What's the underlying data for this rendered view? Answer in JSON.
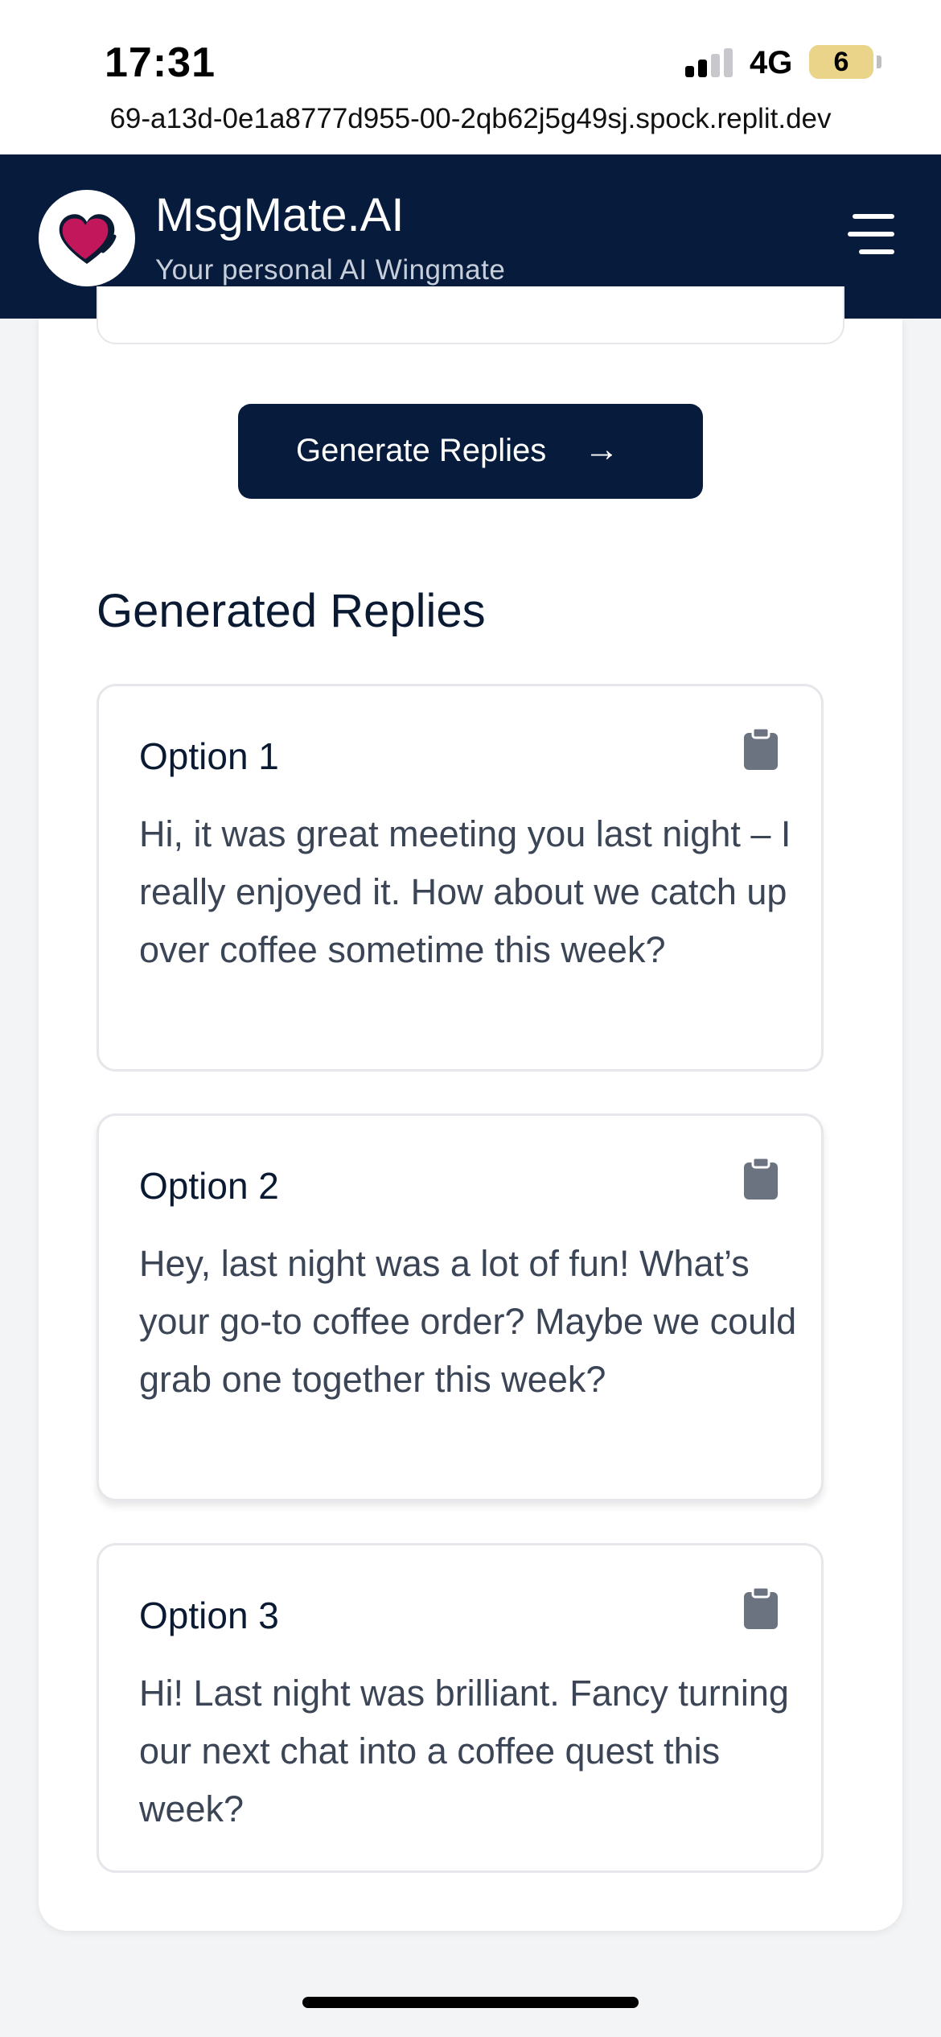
{
  "status_bar": {
    "time": "17:31",
    "network": "4G",
    "battery": "6"
  },
  "browser": {
    "url": "69-a13d-0e1a8777d955-00-2qb62j5g49sj.spock.replit.dev"
  },
  "header": {
    "title": "MsgMate.AI",
    "subtitle": "Your personal AI Wingmate",
    "logo_icon": "heart-logo-icon",
    "menu_icon": "hamburger-menu-icon"
  },
  "actions": {
    "generate_label": "Generate Replies",
    "generate_arrow": "→"
  },
  "replies_section": {
    "title": "Generated Replies",
    "options": [
      {
        "label": "Option 1",
        "text": "Hi, it was great meeting you last night – I really enjoyed it. How about we catch up over coffee sometime this week?"
      },
      {
        "label": "Option 2",
        "text": "Hey, last night was a lot of fun! What’s your go-to coffee order? Maybe we could grab one together this week?"
      },
      {
        "label": "Option 3",
        "text": "Hi! Last night was brilliant. Fancy turning our next chat into a coffee quest this week?"
      }
    ]
  },
  "colors": {
    "navy": "#071c3d",
    "heart": "#c2185b",
    "icon_gray": "#6b7280"
  }
}
